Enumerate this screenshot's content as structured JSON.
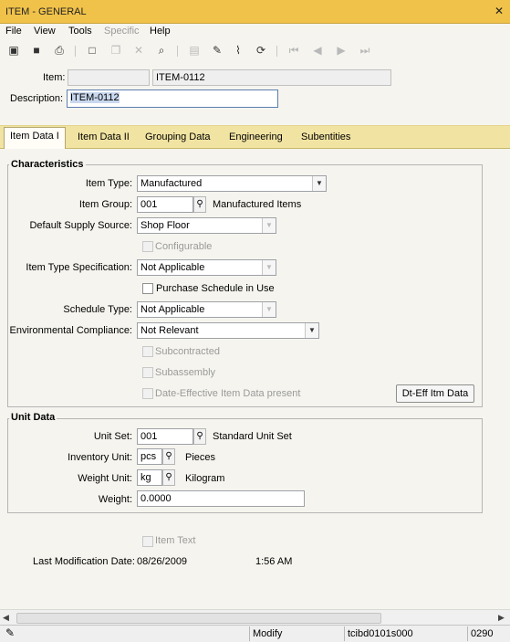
{
  "window": {
    "title": "ITEM - GENERAL",
    "close_glyph": "✕"
  },
  "menu": {
    "file": "File",
    "view": "View",
    "tools": "Tools",
    "specific": "Specific",
    "help": "Help"
  },
  "toolbar_icons": [
    "save-and-exit-icon",
    "save-icon",
    "print-icon",
    "new-icon",
    "copy-icon",
    "delete-icon",
    "find-icon",
    "lock-icon",
    "edit-note-icon",
    "attach-icon",
    "refresh-icon",
    "first-record-icon",
    "prev-record-icon",
    "next-record-icon",
    "last-record-icon"
  ],
  "header": {
    "item_label": "Item:",
    "item_prefix": "",
    "item_value": "ITEM-0112",
    "description_label": "Description:",
    "description_value": "ITEM-0112"
  },
  "tabs": [
    "Item Data I",
    "Item Data II",
    "Grouping Data",
    "Engineering",
    "Subentities"
  ],
  "characteristics": {
    "title": "Characteristics",
    "item_type_label": "Item Type:",
    "item_type_value": "Manufactured",
    "item_group_label": "Item Group:",
    "item_group_value": "001",
    "item_group_desc": "Manufactured Items",
    "supply_source_label": "Default Supply Source:",
    "supply_source_value": "Shop Floor",
    "configurable_label": "Configurable",
    "type_spec_label": "Item Type Specification:",
    "type_spec_value": "Not Applicable",
    "purchase_schedule_label": "Purchase Schedule in Use",
    "schedule_type_label": "Schedule Type:",
    "schedule_type_value": "Not Applicable",
    "env_label": "Environmental Compliance:",
    "env_value": "Not Relevant",
    "subcontracted_label": "Subcontracted",
    "subassembly_label": "Subassembly",
    "date_effective_label": "Date-Effective Item Data present",
    "dt_eff_button": "Dt-Eff Itm Data"
  },
  "unit_data": {
    "title": "Unit Data",
    "unit_set_label": "Unit Set:",
    "unit_set_value": "001",
    "unit_set_desc": "Standard Unit Set",
    "inventory_unit_label": "Inventory Unit:",
    "inventory_unit_value": "pcs",
    "inventory_unit_desc": "Pieces",
    "weight_unit_label": "Weight Unit:",
    "weight_unit_value": "kg",
    "weight_unit_desc": "Kilogram",
    "weight_label": "Weight:",
    "weight_value": "0.0000"
  },
  "footer": {
    "item_text_label": "Item Text",
    "last_mod_label": "Last Modification Date:",
    "last_mod_date": "08/26/2009",
    "last_mod_time": "1:56 AM"
  },
  "status": {
    "mode": "Modify",
    "session": "tcibd0101s000",
    "company": "0290"
  }
}
